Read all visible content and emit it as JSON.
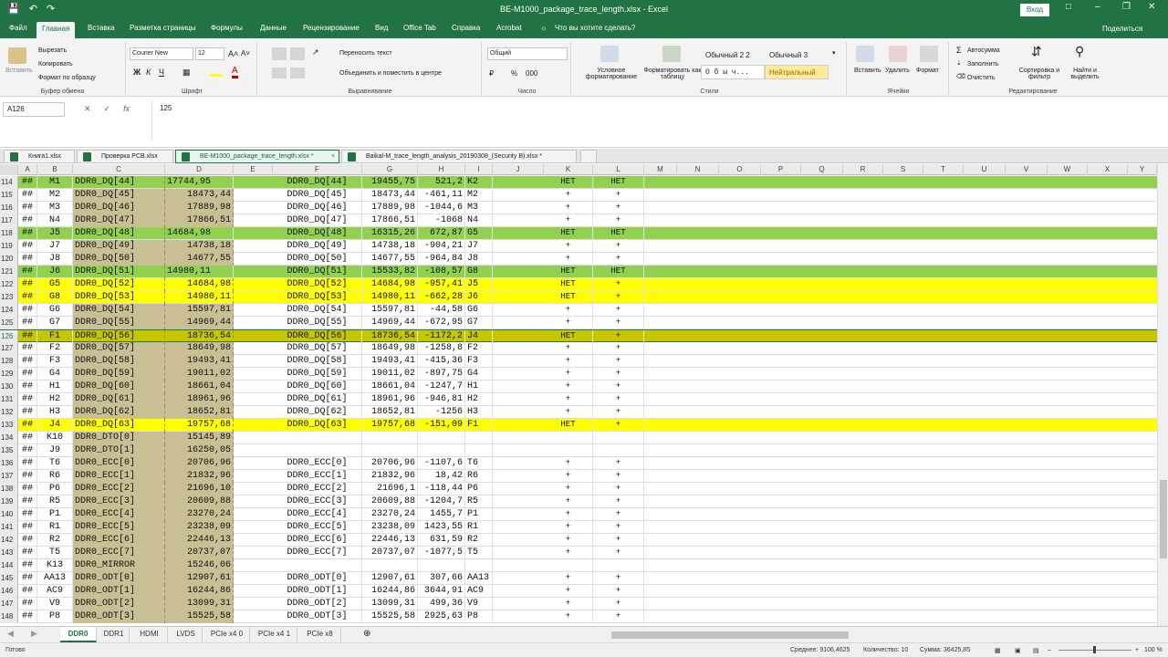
{
  "window": {
    "title": "BE-M1000_package_trace_length.xlsx  -  Excel",
    "signin": "Вход",
    "share": "Поделиться"
  },
  "ribbon_tabs": [
    "Файл",
    "Главная",
    "Вставка",
    "Разметка страницы",
    "Формулы",
    "Данные",
    "Рецензирование",
    "Вид",
    "Office Tab",
    "Справка",
    "Acrobat",
    "Что вы хотите сделать?"
  ],
  "clipboard": {
    "paste": "Вставить",
    "cut": "Вырезать",
    "copy": "Копировать",
    "format_painter": "Формат по образцу",
    "label": "Буфер обмена"
  },
  "font": {
    "name": "Courier New",
    "size": "12",
    "label": "Шрифт",
    "bold": "Ж",
    "italic": "К",
    "underline": "Ч"
  },
  "alignment": {
    "wrap": "Переносить текст",
    "merge": "Объединить и поместить в центре",
    "label": "Выравнивание"
  },
  "number": {
    "format": "Общий",
    "label": "Число"
  },
  "styles": {
    "conditional": "Условное форматирование",
    "as_table": "Форматировать как таблицу",
    "s1": "Обычный 2 2",
    "s2": "Обычный 3",
    "s3": "О б ы ч...",
    "s4": "Нейтральный",
    "label": "Стили"
  },
  "cells": {
    "insert": "Вставить",
    "delete": "Удалить",
    "format": "Формат",
    "label": "Ячейки"
  },
  "editing": {
    "autosum": "Автосумма",
    "fill": "Заполнить",
    "clear": "Очистить",
    "sort": "Сортировка и фильтр",
    "find": "Найти и выделить",
    "label": "Редактирование"
  },
  "formula_bar": {
    "cell_ref": "A126",
    "fx": "fx",
    "value": "125"
  },
  "workbooks": [
    "Книга1.xlsx",
    "Проверка PCB.xlsx",
    "BE-M1000_package_trace_length.xlsx *",
    "Baikal-M_trace_length_analysis_20190308_(Security B).xlsx *"
  ],
  "columns": [
    "A",
    "B",
    "C",
    "D",
    "E",
    "F",
    "G",
    "H",
    "I",
    "J",
    "K",
    "L",
    "M",
    "N",
    "O",
    "P",
    "Q",
    "R",
    "S",
    "T",
    "U",
    "V",
    "W",
    "X",
    "Y"
  ],
  "rows": [
    {
      "n": "114",
      "a": "##",
      "b": "M1",
      "c": "DDR0_DQ[44]",
      "d": "17744,95",
      "f": "DDR0_DQ[44]",
      "g": "19455,75",
      "h": "521,2",
      "i": "K2",
      "k": "НЕТ",
      "l": "НЕТ",
      "fill": "green"
    },
    {
      "n": "115",
      "a": "##",
      "b": "M2",
      "c": "DDR0_DQ[45]",
      "d": "18473,44",
      "f": "DDR0_DQ[45]",
      "g": "18473,44",
      "h": "-461,11",
      "i": "M2",
      "k": "+",
      "l": "+",
      "fill": ""
    },
    {
      "n": "116",
      "a": "##",
      "b": "M3",
      "c": "DDR0_DQ[46]",
      "d": "17889,98",
      "f": "DDR0_DQ[46]",
      "g": "17889,98",
      "h": "-1044,6",
      "i": "M3",
      "k": "+",
      "l": "+",
      "fill": ""
    },
    {
      "n": "117",
      "a": "##",
      "b": "N4",
      "c": "DDR0_DQ[47]",
      "d": "17866,51",
      "f": "DDR0_DQ[47]",
      "g": "17866,51",
      "h": "-1068",
      "i": "N4",
      "k": "+",
      "l": "+",
      "fill": ""
    },
    {
      "n": "118",
      "a": "##",
      "b": "J5",
      "c": "DDR0_DQ[48]",
      "d": "14684,98",
      "f": "DDR0_DQ[48]",
      "g": "16315,26",
      "h": "672,87",
      "i": "G5",
      "k": "НЕТ",
      "l": "НЕТ",
      "fill": "green"
    },
    {
      "n": "119",
      "a": "##",
      "b": "J7",
      "c": "DDR0_DQ[49]",
      "d": "14738,18",
      "f": "DDR0_DQ[49]",
      "g": "14738,18",
      "h": "-904,21",
      "i": "J7",
      "k": "+",
      "l": "+",
      "fill": ""
    },
    {
      "n": "120",
      "a": "##",
      "b": "J8",
      "c": "DDR0_DQ[50]",
      "d": "14677,55",
      "f": "DDR0_DQ[50]",
      "g": "14677,55",
      "h": "-964,84",
      "i": "J8",
      "k": "+",
      "l": "+",
      "fill": ""
    },
    {
      "n": "121",
      "a": "##",
      "b": "J6",
      "c": "DDR0_DQ[51]",
      "d": "14980,11",
      "f": "DDR0_DQ[51]",
      "g": "15533,82",
      "h": "-108,57",
      "i": "G8",
      "k": "НЕТ",
      "l": "НЕТ",
      "fill": "green"
    },
    {
      "n": "122",
      "a": "##",
      "b": "G5",
      "c": "DDR0_DQ[52]",
      "d": "14684,98",
      "f": "DDR0_DQ[52]",
      "g": "14684,98",
      "h": "-957,41",
      "i": "J5",
      "k": "НЕТ",
      "l": "+",
      "fill": "yellow"
    },
    {
      "n": "123",
      "a": "##",
      "b": "G8",
      "c": "DDR0_DQ[53]",
      "d": "14980,11",
      "f": "DDR0_DQ[53]",
      "g": "14980,11",
      "h": "-662,28",
      "i": "J6",
      "k": "НЕТ",
      "l": "+",
      "fill": "yellow"
    },
    {
      "n": "124",
      "a": "##",
      "b": "G6",
      "c": "DDR0_DQ[54]",
      "d": "15597,81",
      "f": "DDR0_DQ[54]",
      "g": "15597,81",
      "h": "-44,58",
      "i": "G6",
      "k": "+",
      "l": "+",
      "fill": ""
    },
    {
      "n": "125",
      "a": "##",
      "b": "G7",
      "c": "DDR0_DQ[55]",
      "d": "14969,44",
      "f": "DDR0_DQ[55]",
      "g": "14969,44",
      "h": "-672,95",
      "i": "G7",
      "k": "+",
      "l": "+",
      "fill": ""
    },
    {
      "n": "126",
      "a": "##",
      "b": "F1",
      "c": "DDR0_DQ[56]",
      "d": "18736,54",
      "f": "DDR0_DQ[56]",
      "g": "18736,54",
      "h": "-1172,2",
      "i": "J4",
      "k": "НЕТ",
      "l": "+",
      "fill": "olive"
    },
    {
      "n": "127",
      "a": "##",
      "b": "F2",
      "c": "DDR0_DQ[57]",
      "d": "18649,98",
      "f": "DDR0_DQ[57]",
      "g": "18649,98",
      "h": "-1258,8",
      "i": "F2",
      "k": "+",
      "l": "+",
      "fill": ""
    },
    {
      "n": "128",
      "a": "##",
      "b": "F3",
      "c": "DDR0_DQ[58]",
      "d": "19493,41",
      "f": "DDR0_DQ[58]",
      "g": "19493,41",
      "h": "-415,36",
      "i": "F3",
      "k": "+",
      "l": "+",
      "fill": ""
    },
    {
      "n": "129",
      "a": "##",
      "b": "G4",
      "c": "DDR0_DQ[59]",
      "d": "19011,02",
      "f": "DDR0_DQ[59]",
      "g": "19011,02",
      "h": "-897,75",
      "i": "G4",
      "k": "+",
      "l": "+",
      "fill": ""
    },
    {
      "n": "130",
      "a": "##",
      "b": "H1",
      "c": "DDR0_DQ[60]",
      "d": "18661,04",
      "f": "DDR0_DQ[60]",
      "g": "18661,04",
      "h": "-1247,7",
      "i": "H1",
      "k": "+",
      "l": "+",
      "fill": ""
    },
    {
      "n": "131",
      "a": "##",
      "b": "H2",
      "c": "DDR0_DQ[61]",
      "d": "18961,96",
      "f": "DDR0_DQ[61]",
      "g": "18961,96",
      "h": "-946,81",
      "i": "H2",
      "k": "+",
      "l": "+",
      "fill": ""
    },
    {
      "n": "132",
      "a": "##",
      "b": "H3",
      "c": "DDR0_DQ[62]",
      "d": "18652,81",
      "f": "DDR0_DQ[62]",
      "g": "18652,81",
      "h": "-1256",
      "i": "H3",
      "k": "+",
      "l": "+",
      "fill": ""
    },
    {
      "n": "133",
      "a": "##",
      "b": "J4",
      "c": "DDR0_DQ[63]",
      "d": "19757,68",
      "f": "DDR0_DQ[63]",
      "g": "19757,68",
      "h": "-151,09",
      "i": "F1",
      "k": "НЕТ",
      "l": "+",
      "fill": "yellow"
    },
    {
      "n": "134",
      "a": "##",
      "b": "K10",
      "c": "DDR0_DTO[0]",
      "d": "15145,89",
      "f": "",
      "g": "",
      "h": "",
      "i": "",
      "k": "",
      "l": "",
      "fill": ""
    },
    {
      "n": "135",
      "a": "##",
      "b": "J9",
      "c": "DDR0_DTO[1]",
      "d": "16250,05",
      "f": "",
      "g": "",
      "h": "",
      "i": "",
      "k": "",
      "l": "",
      "fill": ""
    },
    {
      "n": "136",
      "a": "##",
      "b": "T6",
      "c": "DDR0_ECC[0]",
      "d": "20706,96",
      "f": "DDR0_ECC[0]",
      "g": "20706,96",
      "h": "-1107,6",
      "i": "T6",
      "k": "+",
      "l": "+",
      "fill": ""
    },
    {
      "n": "137",
      "a": "##",
      "b": "R6",
      "c": "DDR0_ECC[1]",
      "d": "21832,96",
      "f": "DDR0_ECC[1]",
      "g": "21832,96",
      "h": "18,42",
      "i": "R6",
      "k": "+",
      "l": "+",
      "fill": ""
    },
    {
      "n": "138",
      "a": "##",
      "b": "P6",
      "c": "DDR0_ECC[2]",
      "d": "21696,10",
      "f": "DDR0_ECC[2]",
      "g": "21696,1",
      "h": "-118,44",
      "i": "P6",
      "k": "+",
      "l": "+",
      "fill": ""
    },
    {
      "n": "139",
      "a": "##",
      "b": "R5",
      "c": "DDR0_ECC[3]",
      "d": "20609,88",
      "f": "DDR0_ECC[3]",
      "g": "20609,88",
      "h": "-1204,7",
      "i": "R5",
      "k": "+",
      "l": "+",
      "fill": ""
    },
    {
      "n": "140",
      "a": "##",
      "b": "P1",
      "c": "DDR0_ECC[4]",
      "d": "23270,24",
      "f": "DDR0_ECC[4]",
      "g": "23270,24",
      "h": "1455,7",
      "i": "P1",
      "k": "+",
      "l": "+",
      "fill": ""
    },
    {
      "n": "141",
      "a": "##",
      "b": "R1",
      "c": "DDR0_ECC[5]",
      "d": "23238,09",
      "f": "DDR0_ECC[5]",
      "g": "23238,09",
      "h": "1423,55",
      "i": "R1",
      "k": "+",
      "l": "+",
      "fill": ""
    },
    {
      "n": "142",
      "a": "##",
      "b": "R2",
      "c": "DDR0_ECC[6]",
      "d": "22446,13",
      "f": "DDR0_ECC[6]",
      "g": "22446,13",
      "h": "631,59",
      "i": "R2",
      "k": "+",
      "l": "+",
      "fill": ""
    },
    {
      "n": "143",
      "a": "##",
      "b": "T5",
      "c": "DDR0_ECC[7]",
      "d": "20737,07",
      "f": "DDR0_ECC[7]",
      "g": "20737,07",
      "h": "-1077,5",
      "i": "T5",
      "k": "+",
      "l": "+",
      "fill": ""
    },
    {
      "n": "144",
      "a": "##",
      "b": "K13",
      "c": "DDR0_MIRROR",
      "d": "15246,06",
      "f": "",
      "g": "",
      "h": "",
      "i": "",
      "k": "",
      "l": "",
      "fill": ""
    },
    {
      "n": "145",
      "a": "##",
      "b": "AA13",
      "c": "DDR0_ODT[0]",
      "d": "12907,61",
      "f": "DDR0_ODT[0]",
      "g": "12907,61",
      "h": "307,66",
      "i": "AA13",
      "k": "+",
      "l": "+",
      "fill": ""
    },
    {
      "n": "146",
      "a": "##",
      "b": "AC9",
      "c": "DDR0_ODT[1]",
      "d": "16244,86",
      "f": "DDR0_ODT[1]",
      "g": "16244,86",
      "h": "3644,91",
      "i": "AC9",
      "k": "+",
      "l": "+",
      "fill": ""
    },
    {
      "n": "147",
      "a": "##",
      "b": "V9",
      "c": "DDR0_ODT[2]",
      "d": "13099,31",
      "f": "DDR0_ODT[2]",
      "g": "13099,31",
      "h": "499,36",
      "i": "V9",
      "k": "+",
      "l": "+",
      "fill": ""
    },
    {
      "n": "148",
      "a": "##",
      "b": "P8",
      "c": "DDR0_ODT[3]",
      "d": "15525,58",
      "f": "DDR0_ODT[3]",
      "g": "15525,58",
      "h": "2925,63",
      "i": "P8",
      "k": "+",
      "l": "+",
      "fill": ""
    }
  ],
  "sheets": [
    "DDR0",
    "DDR1",
    "HDMI",
    "LVDS",
    "PCIe x4 0",
    "PCIe x4 1",
    "PCIe x8"
  ],
  "status": {
    "ready": "Готово",
    "avg": "Среднее: 9106,4625",
    "count": "Количество: 10",
    "sum": "Сумма: 36425,85",
    "zoom": "100 %"
  },
  "colors": {
    "accent": "#217346",
    "green_row": "#92d050",
    "yellow_row": "#ffff00",
    "olive_row": "#c7c700",
    "shaded": "#c9bf94"
  }
}
